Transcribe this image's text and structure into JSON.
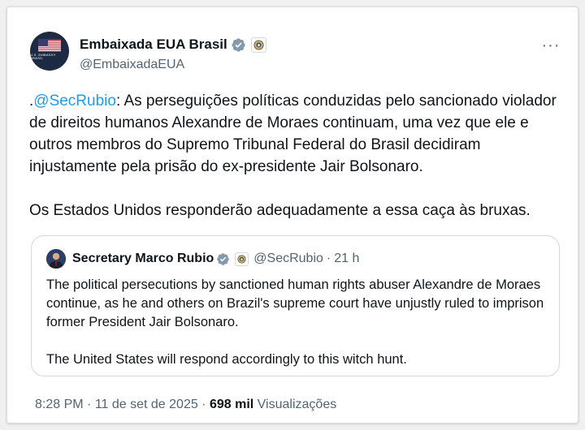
{
  "tweet": {
    "author_name": "Embaixada EUA Brasil",
    "author_handle": "@EmbaixadaEUA",
    "avatar_caption": "U.S. EMBASSY BRASIL",
    "more_label": "···",
    "mention": "@SecRubio",
    "lead_dot": ".",
    "paragraph1_rest": ": As perseguições políticas conduzidas pelo sancionado violador de direitos humanos Alexandre de Moraes continuam, uma vez que ele e outros membros do Supremo Tribunal Federal do Brasil decidiram injustamente pela prisão do ex-presidente Jair Bolsonaro.",
    "paragraph2": "Os Estados Unidos responderão adequadamente a essa caça às bruxas.",
    "time": "8:28 PM",
    "date": "11 de set de 2025",
    "sep": " · ",
    "views_count": "698 mil",
    "views_label": "Visualizações"
  },
  "quote": {
    "author_name": "Secretary Marco Rubio",
    "author_handle": "@SecRubio",
    "dot": "·",
    "age": "21 h",
    "paragraph1": "The political persecutions by sanctioned human rights abuser Alexandre de Moraes continue, as he and others on Brazil's supreme court have unjustly ruled to imprison former President Jair Bolsonaro.",
    "paragraph2": "The United States will respond accordingly to this witch hunt."
  },
  "colors": {
    "link": "#1d9bf0",
    "verified_badge": "#829aab",
    "secondary_text": "#536471"
  },
  "icons": [
    "gray-verified-badge-icon",
    "government-seal-icon",
    "more-options-icon"
  ]
}
